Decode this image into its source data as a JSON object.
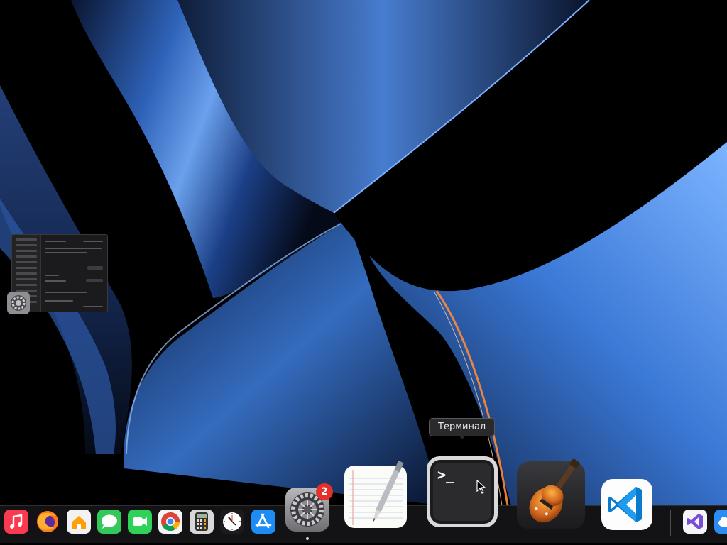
{
  "tooltip": {
    "text": "Терминал"
  },
  "dock": {
    "items": [
      {
        "app": "music",
        "icon": "music-icon"
      },
      {
        "app": "firefox",
        "icon": "firefox-icon"
      },
      {
        "app": "home",
        "icon": "home-icon"
      },
      {
        "app": "messages",
        "icon": "messages-icon"
      },
      {
        "app": "facetime",
        "icon": "facetime-icon"
      },
      {
        "app": "chrome",
        "icon": "chrome-icon"
      },
      {
        "app": "calculator",
        "icon": "calculator-icon"
      },
      {
        "app": "clock",
        "icon": "clock-icon"
      },
      {
        "app": "app-store",
        "icon": "app-store-icon"
      },
      {
        "app": "system-settings",
        "icon": "gear-icon",
        "badge": "2"
      },
      {
        "app": "textedit",
        "icon": "textedit-icon"
      },
      {
        "app": "terminal",
        "icon": "terminal-icon"
      },
      {
        "app": "garageband",
        "icon": "guitar-icon"
      },
      {
        "app": "vscode",
        "icon": "vscode-icon"
      },
      {
        "app": "visual-studio",
        "icon": "visual-studio-icon"
      },
      {
        "app": "icloud",
        "icon": "cloud-icon"
      }
    ]
  },
  "colors": {
    "wallpaper_blue": "#3a78d6",
    "wallpaper_deep": "#0b1a3a",
    "accent_orange": "#ff8a3a",
    "badge_red": "#e5312c",
    "tooltip_bg": "#2a2a2c"
  }
}
